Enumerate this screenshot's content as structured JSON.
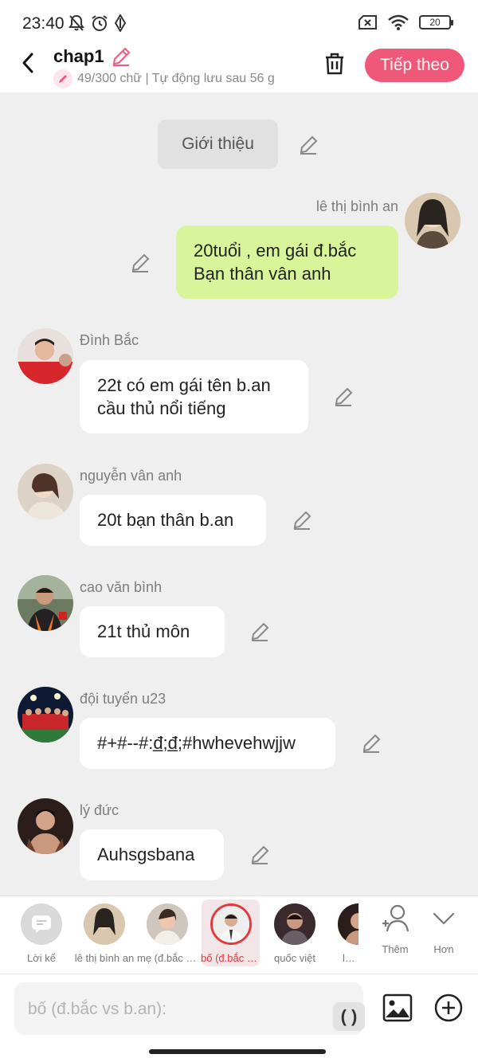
{
  "status_bar": {
    "time": "23:40",
    "battery": "20"
  },
  "header": {
    "title": "chap1",
    "subtitle": "49/300 chữ | Tự động lưu sau 56 g",
    "next_label": "Tiếp theo"
  },
  "chat": {
    "intro_label": "Giới thiệu",
    "messages": [
      {
        "sender": "lê thị bình an",
        "text": "20tuổi , em gái đ.bắc\nBạn thân vân anh"
      },
      {
        "sender": "Đình Bắc",
        "text": "22t có em gái tên b.an\ncầu thủ nổi tiếng"
      },
      {
        "sender": "nguyễn vân anh",
        "text": "20t bạn thân b.an"
      },
      {
        "sender": "cao văn bình",
        "text": "21t thủ môn"
      },
      {
        "sender": "đội tuyển u23",
        "text": "#+#--#:đ̲;đ̲;#hwhevehwjjw"
      },
      {
        "sender": "lý đức",
        "text": "Auhsgsbana"
      }
    ]
  },
  "character_bar": {
    "items": [
      {
        "label": "Lời kể"
      },
      {
        "label": "lê thị bình an"
      },
      {
        "label": "mẹ (đ.bắc vs b.an)"
      },
      {
        "label": "bố (đ.bắc vs b.an)"
      },
      {
        "label": "quốc việt"
      },
      {
        "label": "lý đức"
      }
    ],
    "more_label": "Thêm",
    "less_label": "Hơn"
  },
  "input": {
    "placeholder": "bố (đ.bắc vs b.an):",
    "paren_label": "( )"
  },
  "colors": {
    "accent": "#f0587a",
    "my_bubble": "#d9f59a",
    "selected": "#e23b3b"
  }
}
